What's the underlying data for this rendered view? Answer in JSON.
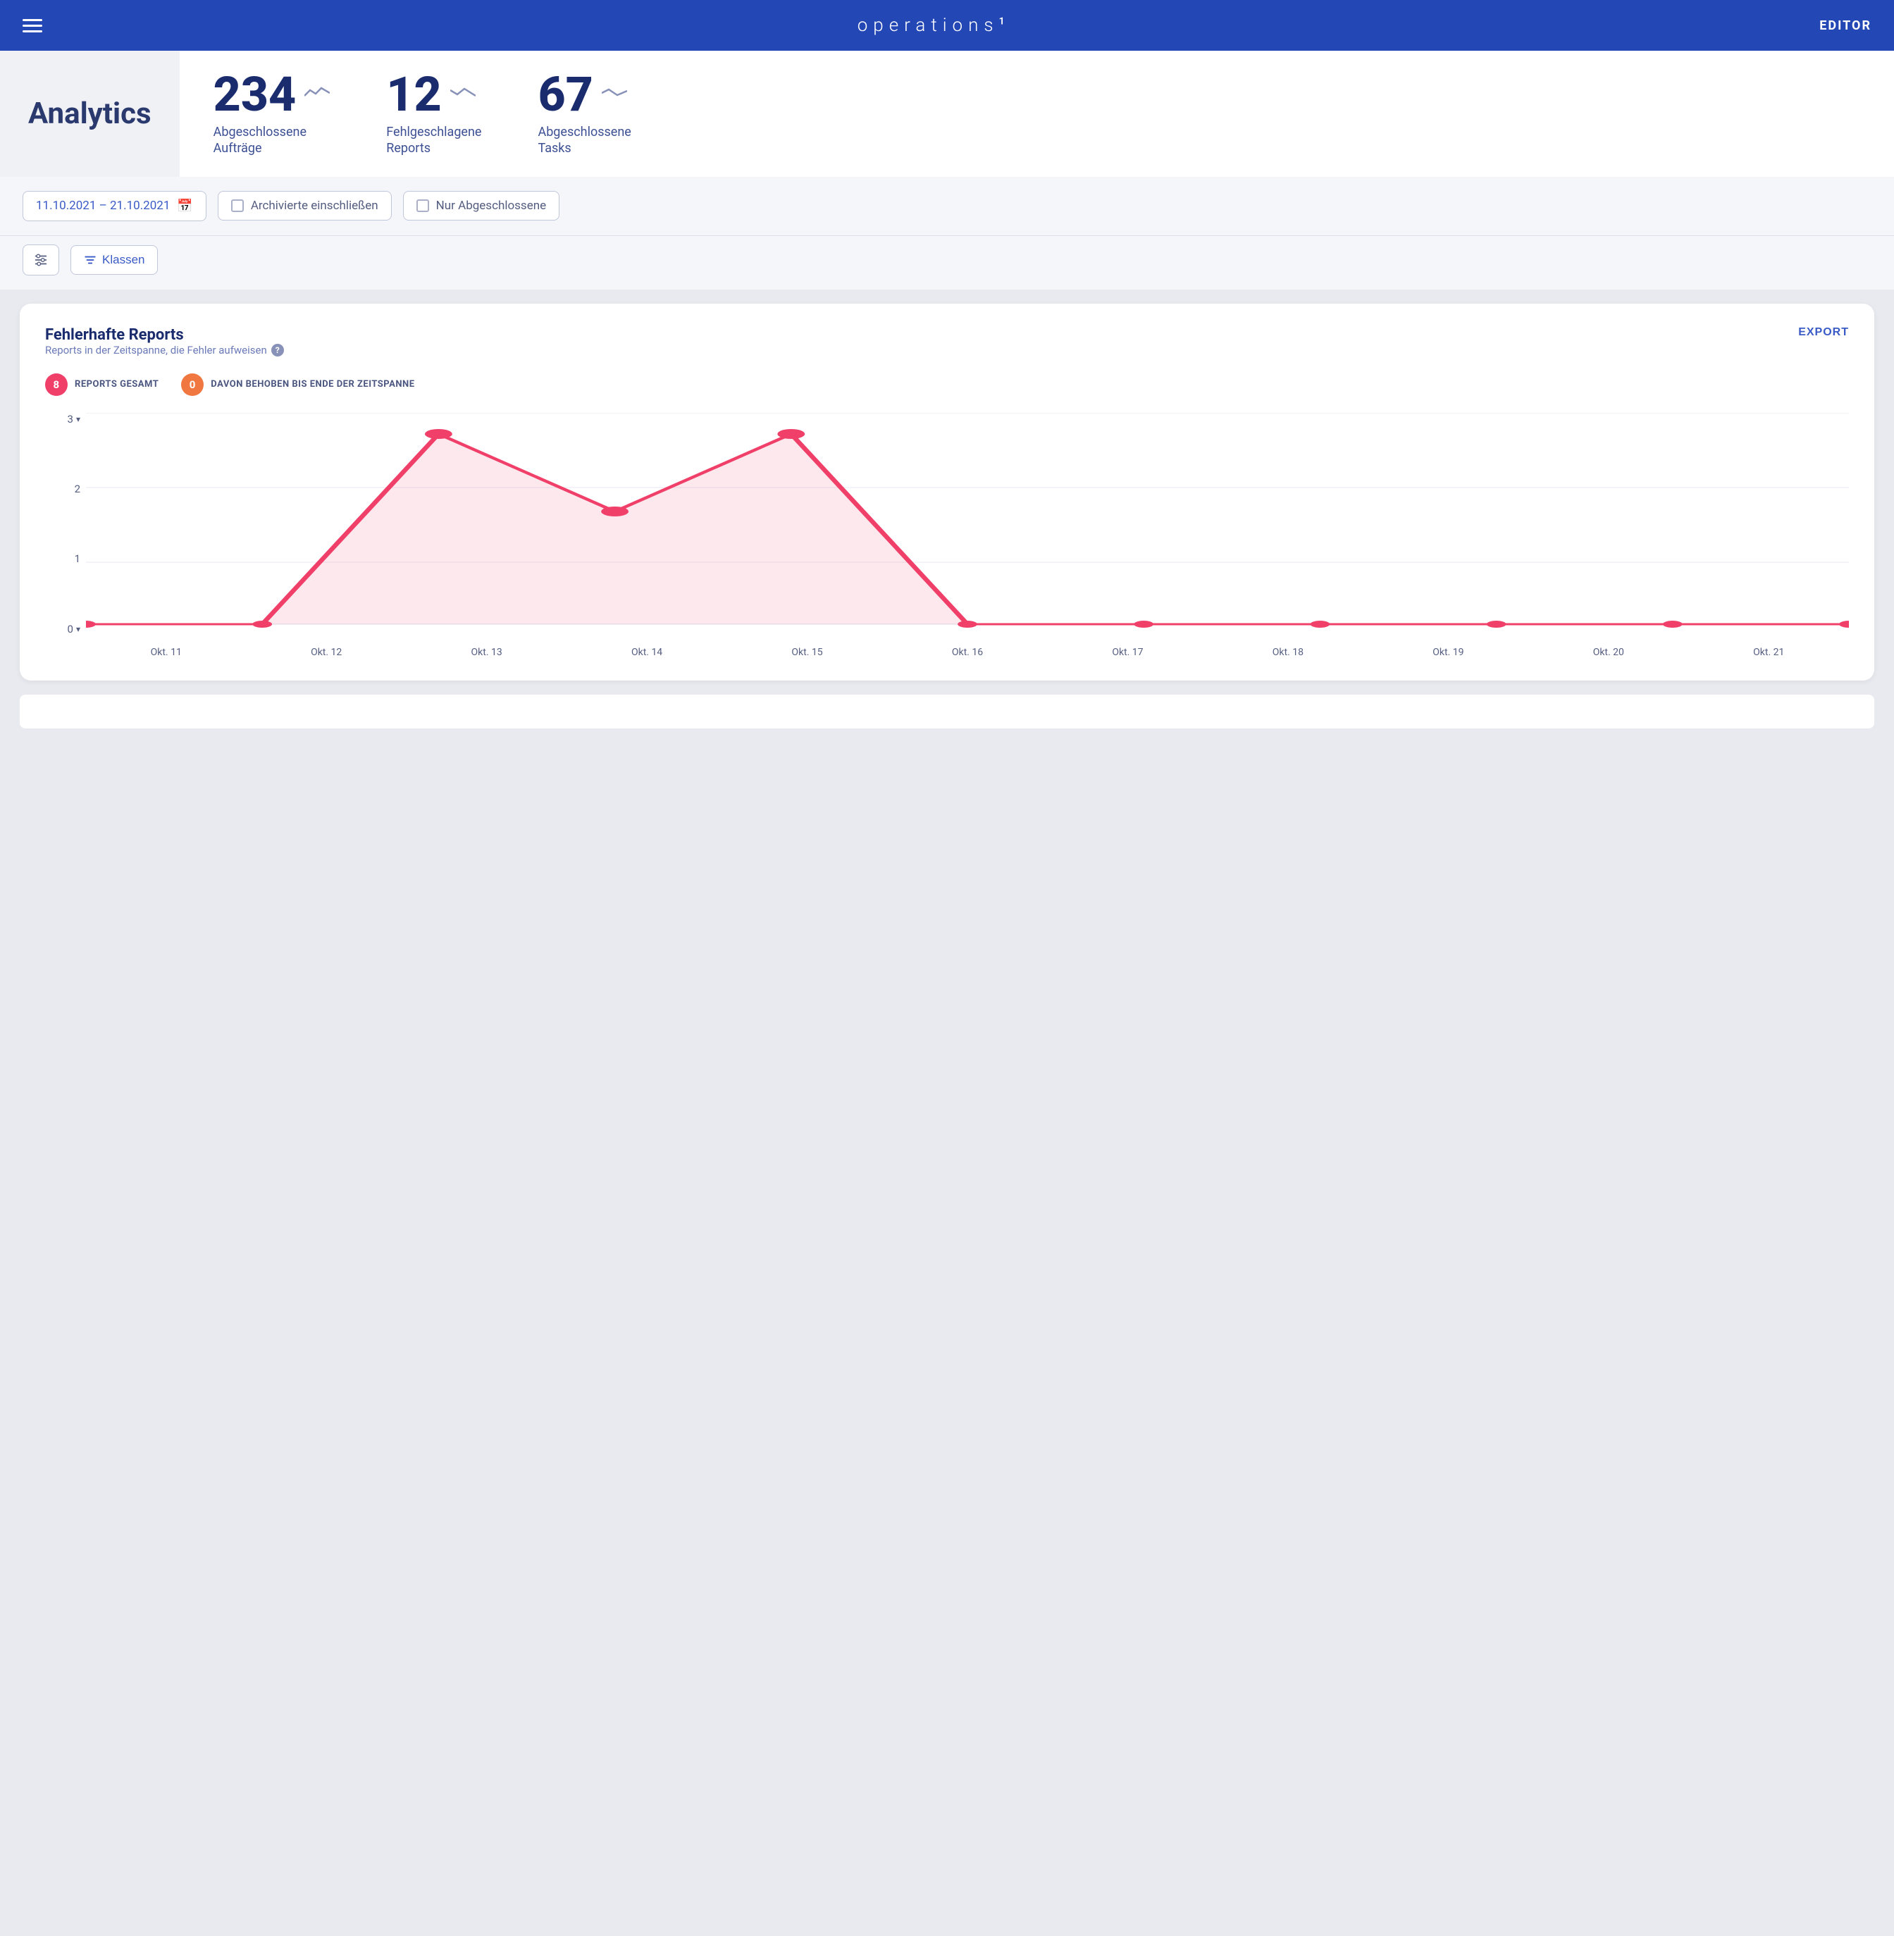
{
  "header": {
    "title": "operations",
    "superscript": "1",
    "editor_label": "EDITOR"
  },
  "stats": {
    "analytics_label": "Analytics",
    "items": [
      {
        "number": "234",
        "label": "Abgeschlossene\nAufträge",
        "trend": "~"
      },
      {
        "number": "12",
        "label": "Fehlgeschlagene\nReports",
        "trend": "~"
      },
      {
        "number": "67",
        "label": "Abgeschlossene\nTasks",
        "trend": "~"
      }
    ]
  },
  "filters": {
    "date_range": "11.10.2021 – 21.10.2021",
    "archivierte": "Archivierte einschließen",
    "nur": "Nur Abgeschlossene"
  },
  "controls": {
    "klassen_label": "Klassen"
  },
  "chart": {
    "title": "Fehlerhafte Reports",
    "subtitle": "Reports in der Zeitspanne, die Fehler aufweisen",
    "export_label": "EXPORT",
    "legend": [
      {
        "value": "8",
        "label": "REPORTS GESAMT",
        "color": "pink"
      },
      {
        "value": "0",
        "label": "DAVON BEHOBEN BIS ENDE DER ZEITSPANNE",
        "color": "orange"
      }
    ],
    "y_max": "3",
    "y_min": "0",
    "x_labels": [
      "Okt. 11",
      "Okt. 12",
      "Okt. 13",
      "Okt. 14",
      "Okt. 15",
      "Okt. 16",
      "Okt. 17",
      "Okt. 18",
      "Okt. 19",
      "Okt. 20",
      "Okt. 21"
    ],
    "data_points": [
      0,
      0,
      3,
      2,
      3,
      0,
      0,
      0,
      0,
      0,
      0
    ]
  }
}
